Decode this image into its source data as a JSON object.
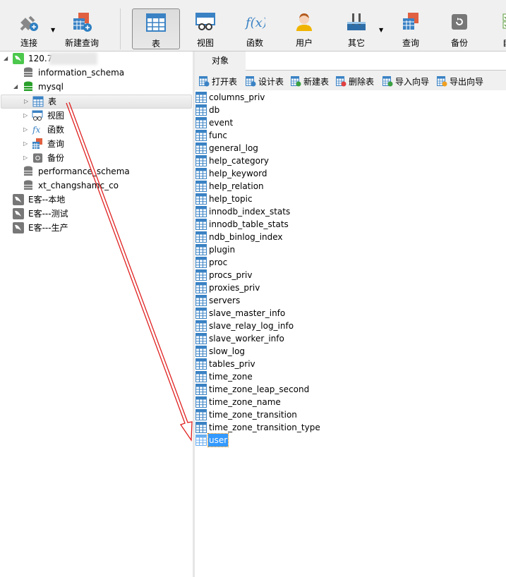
{
  "toolbar": {
    "items": [
      {
        "label": "连接",
        "icon": "plug-add-icon"
      },
      {
        "label": "新建查询",
        "icon": "new-query-icon"
      },
      {
        "label": "表",
        "icon": "table-icon",
        "selected": true
      },
      {
        "label": "视图",
        "icon": "view-icon"
      },
      {
        "label": "函数",
        "icon": "function-icon"
      },
      {
        "label": "用户",
        "icon": "user-icon"
      },
      {
        "label": "其它",
        "icon": "tools-icon"
      },
      {
        "label": "查询",
        "icon": "query-icon"
      },
      {
        "label": "备份",
        "icon": "backup-icon"
      },
      {
        "label": "自动",
        "icon": "automation-icon"
      }
    ]
  },
  "tree": {
    "connection": "120.7",
    "databases": [
      "information_schema",
      "mysql",
      "performance_schema",
      "xt_changshamc_co"
    ],
    "mysql_children": [
      "表",
      "视图",
      "函数",
      "查询",
      "备份"
    ],
    "other_connections": [
      "E客--本地",
      "E客---测试",
      "E客---生产"
    ]
  },
  "right": {
    "tab": "对象",
    "actions": [
      "打开表",
      "设计表",
      "新建表",
      "删除表",
      "导入向导",
      "导出向导"
    ],
    "tables": [
      "columns_priv",
      "db",
      "event",
      "func",
      "general_log",
      "help_category",
      "help_keyword",
      "help_relation",
      "help_topic",
      "innodb_index_stats",
      "innodb_table_stats",
      "ndb_binlog_index",
      "plugin",
      "proc",
      "procs_priv",
      "proxies_priv",
      "servers",
      "slave_master_info",
      "slave_relay_log_info",
      "slave_worker_info",
      "slow_log",
      "tables_priv",
      "time_zone",
      "time_zone_leap_second",
      "time_zone_name",
      "time_zone_transition",
      "time_zone_transition_type",
      "user"
    ],
    "selected_table": "user"
  },
  "colors": {
    "accent": "#3399ff",
    "annotation_arrow": "#e02020",
    "table_icon": "#3a82c4"
  }
}
